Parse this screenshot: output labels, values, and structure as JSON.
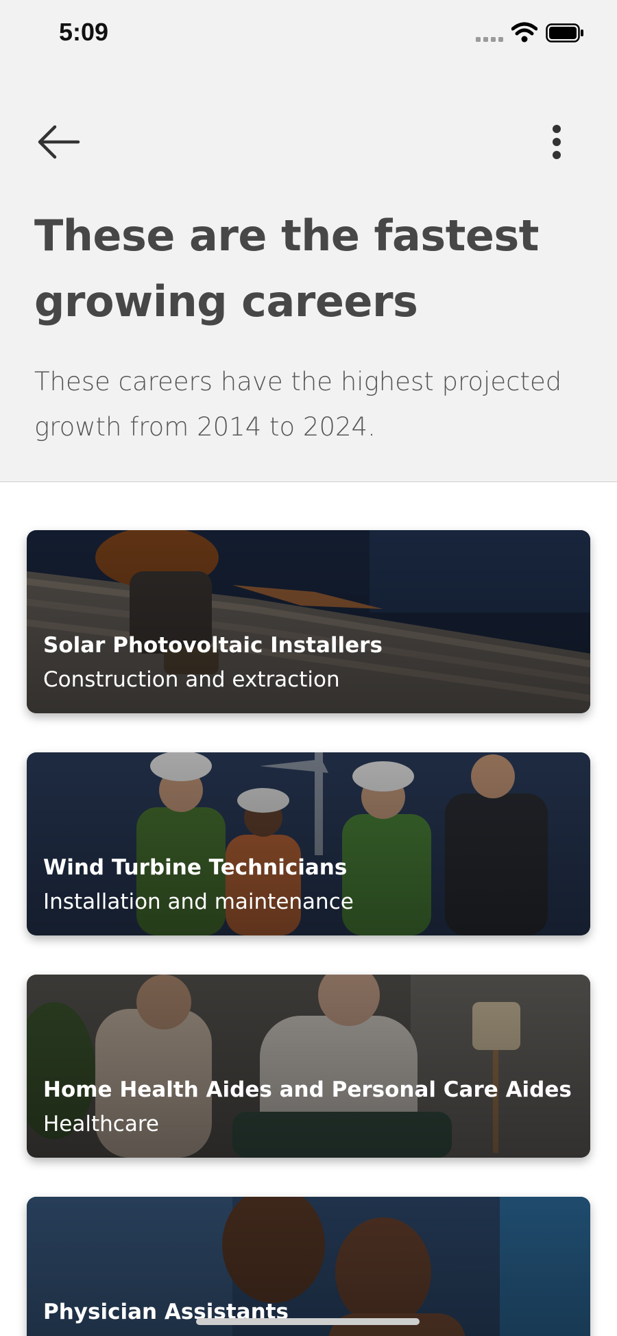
{
  "status_bar": {
    "time": "5:09"
  },
  "header": {
    "back_icon": "arrow-left-icon",
    "more_icon": "more-vertical-icon",
    "title": "These are the fastest growing careers",
    "subtitle": "These careers have the highest projected growth from 2014 to 2024."
  },
  "careers": [
    {
      "title": "Solar Photovoltaic Installers",
      "category": "Construction and extraction"
    },
    {
      "title": "Wind Turbine Technicians",
      "category": "Installation and maintenance"
    },
    {
      "title": "Home Health Aides and Personal Care Aides",
      "category": "Healthcare"
    },
    {
      "title": "Physician Assistants",
      "category": ""
    }
  ],
  "colors": {
    "header_bg": "#f2f2f2",
    "title_text": "#474747",
    "body_text": "#555555",
    "card_text": "#ffffff"
  }
}
